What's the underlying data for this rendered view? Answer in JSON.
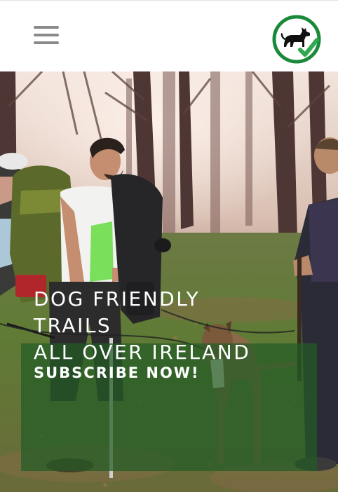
{
  "header": {
    "menu_icon": "hamburger-menu-icon",
    "logo_icon": "dog-friendly-check-logo-icon",
    "logo_colors": {
      "ring": "#1a8a3a",
      "dog": "#111111",
      "check": "#2fa84f"
    }
  },
  "hero": {
    "image": "hikers-with-backpacks-and-dog-in-forest",
    "title_lines": [
      "DOG FRIENDLY",
      "TRAILS",
      "ALL OVER IRELAND"
    ],
    "cta_label": "SUBSCRIBE NOW!",
    "overlay_color": "#225c26"
  }
}
